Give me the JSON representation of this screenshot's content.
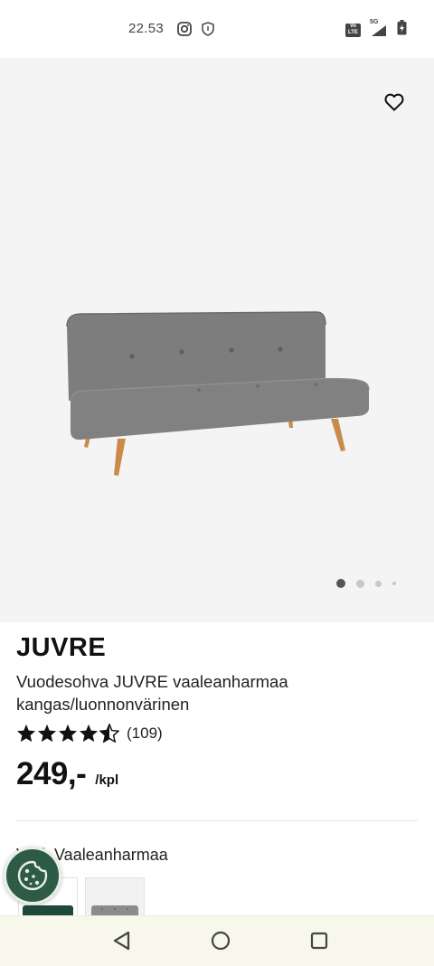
{
  "status_bar": {
    "time": "22.53",
    "icons": [
      "instagram-icon",
      "shield-icon",
      "volte-icon",
      "signal-5g-icon",
      "battery-charging-icon"
    ],
    "volte_text": "Vo LTE",
    "network": "5G"
  },
  "gallery": {
    "active_index": 0,
    "image_count": 4
  },
  "product": {
    "brand": "JUVRE",
    "description": "Vuodesohva JUVRE vaaleanharmaa kangas/luonnonvärinen",
    "rating": 4.5,
    "review_count": "(109)",
    "price": "249,-",
    "price_unit": "/kpl",
    "color_label": "Väri: Vaaleanharmaa"
  },
  "colors": {
    "accent_green": "#2e5b45",
    "sofa_grey": "#7b7b7b",
    "wood_leg": "#c98a4a"
  }
}
